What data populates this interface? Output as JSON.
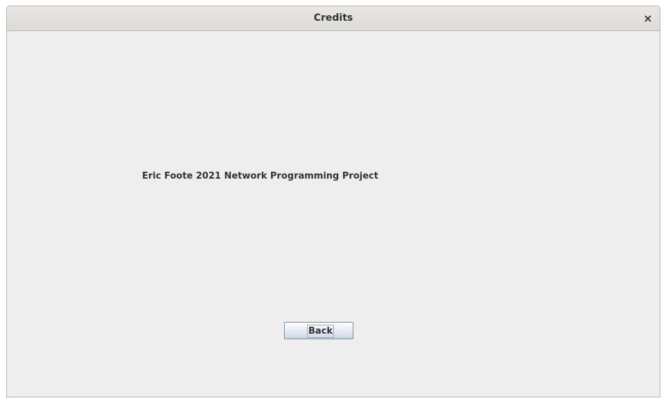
{
  "window": {
    "title": "Credits",
    "close_glyph": "×"
  },
  "main": {
    "credit_text": "Eric Foote 2021 Network Programming Project",
    "back_label": "Back"
  }
}
